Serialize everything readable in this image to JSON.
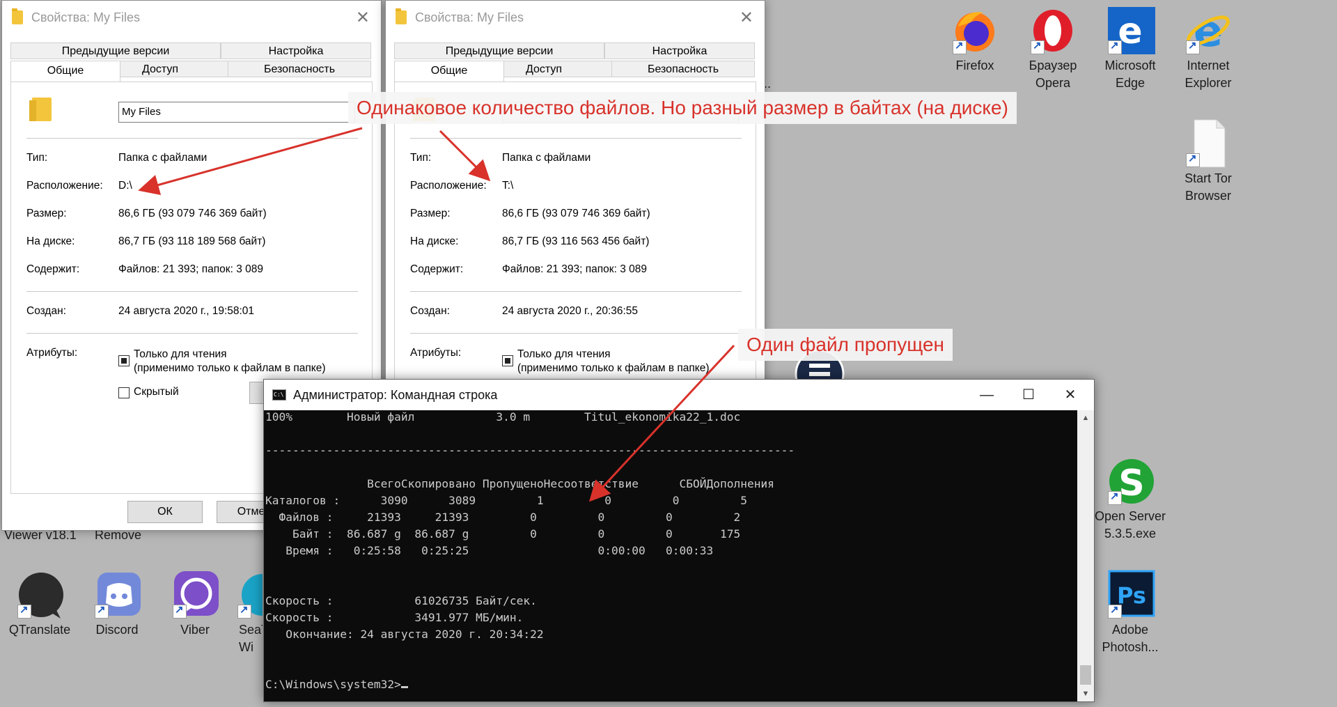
{
  "left_window": {
    "title": "Свойства: My Files",
    "tabs": [
      "Предыдущие версии",
      "Настройка",
      "Общие",
      "Доступ",
      "Безопасность"
    ],
    "name": "My Files",
    "type_label": "Тип:",
    "type_value": "Папка с файлами",
    "location_label": "Расположение:",
    "location_value": "D:\\",
    "size_label": "Размер:",
    "size_value": "86,6 ГБ (93 079 746 369 байт)",
    "ondisk_label": "На диске:",
    "ondisk_value": "86,7 ГБ (93 118 189 568 байт)",
    "contains_label": "Содержит:",
    "contains_value": "Файлов: 21 393; папок: 3 089",
    "created_label": "Создан:",
    "created_value": "24 августа 2020 г., 19:58:01",
    "attributes_label": "Атрибуты:",
    "readonly_line1": "Только для чтения",
    "readonly_line2": "(применимо только к файлам в папке)",
    "hidden_label": "Скрытый",
    "ok_label": "ОК",
    "cancel_label": "Отмен"
  },
  "right_window": {
    "title": "Свойства: My Files",
    "tabs": [
      "Предыдущие версии",
      "Настройка",
      "Общие",
      "Доступ",
      "Безопасность"
    ],
    "type_label": "Тип:",
    "type_value": "Папка с файлами",
    "location_label": "Расположение:",
    "location_value": "T:\\",
    "size_label": "Размер:",
    "size_value": "86,6 ГБ (93 079 746 369 байт)",
    "ondisk_label": "На диске:",
    "ondisk_value": "86,7 ГБ (93 116 563 456 байт)",
    "contains_label": "Содержит:",
    "contains_value": "Файлов: 21 393; папок: 3 089",
    "created_label": "Создан:",
    "created_value": "24 августа 2020 г., 20:36:55",
    "attributes_label": "Атрибуты:",
    "readonly_line1": "Только для чтения",
    "readonly_line2": "(применимо только к файлам в папке)"
  },
  "cmd": {
    "title": "Администратор: Командная строка",
    "lines": [
      "100%        Новый файл            3.0 m        Titul_ekonomika22_1.doc",
      "",
      "------------------------------------------------------------------------------",
      "",
      "               ВсегоСкопировано ПропущеноНесоответствие      СБОЙДополнения",
      "Каталогов :      3090      3089         1         0         0         5",
      "  Файлов :     21393     21393         0         0         0         2",
      "    Байт :  86.687 g  86.687 g         0         0         0       175",
      "   Время :   0:25:58   0:25:25                   0:00:00   0:00:33",
      "",
      "",
      "Скорость :            61026735 Байт/сек.",
      "Скорость :            3491.977 МБ/мин.",
      "   Окончание: 24 августа 2020 г. 20:34:22",
      "",
      "",
      "C:\\Windows\\system32>"
    ]
  },
  "annotations": {
    "top": "Одинаковое количество файлов. Но разный размер в байтах (на диске)",
    "middle": "Один файл пропущен",
    "color": "#d8322b"
  },
  "desktop_icons": {
    "firefox": "Firefox",
    "opera_1": "Браузер",
    "opera_2": "Opera",
    "edge_1": "Microsoft",
    "edge_2": "Edge",
    "ie_1": "Internet",
    "ie_2": "Explorer",
    "tor_1": "Start Tor",
    "tor_2": "Browser",
    "openserver_1": "Open Server",
    "openserver_2": "5.3.5.exe",
    "photoshop_1": "Adobe",
    "photoshop_2": "Photosh...",
    "qtranslate": "QTranslate",
    "discord": "Discord",
    "viber": "Viber",
    "seatools_1": "SeaT",
    "seatools_2": "Wi",
    "partial_viewer": "Viewer v18.1",
    "partial_remove": "Remove",
    "partial_dots": "..."
  }
}
